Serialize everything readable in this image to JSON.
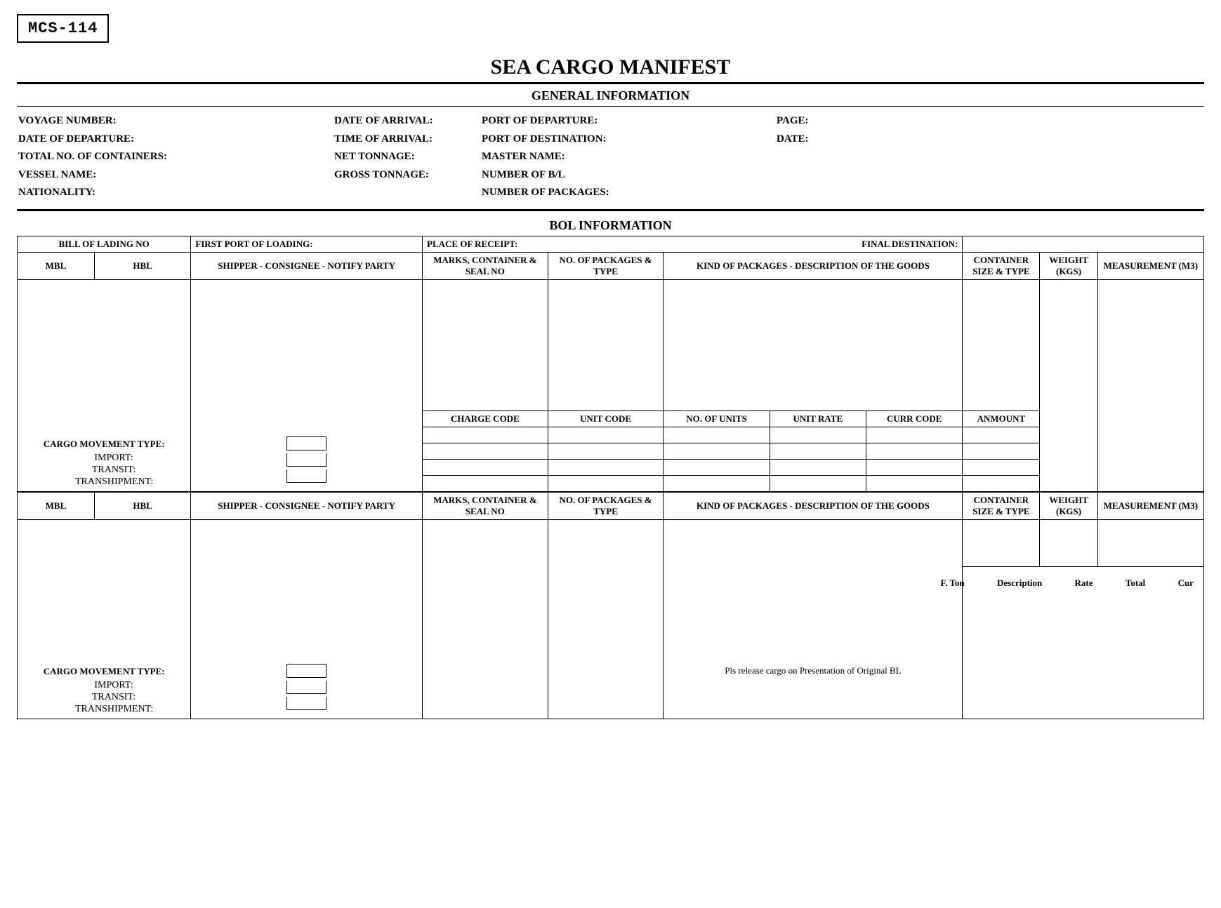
{
  "form_code": "MCS-114",
  "title": "SEA CARGO MANIFEST",
  "sections": {
    "general": "GENERAL INFORMATION",
    "bol": "BOL INFORMATION"
  },
  "general_info": {
    "col1": [
      "VOYAGE NUMBER:",
      "DATE OF DEPARTURE:",
      "TOTAL NO. OF CONTAINERS:",
      "VESSEL NAME:",
      "NATIONALITY:"
    ],
    "col2": [
      "DATE OF ARRIVAL:",
      "TIME OF ARRIVAL:",
      "NET TONNAGE:",
      "GROSS TONNAGE:",
      ""
    ],
    "col3": [
      "PORT OF DEPARTURE:",
      "PORT OF DESTINATION:",
      "MASTER NAME:",
      "NUMBER OF B/L",
      "NUMBER OF PACKAGES:"
    ],
    "col4": [
      "PAGE:",
      "DATE:",
      "",
      "",
      ""
    ]
  },
  "bol": {
    "row1": {
      "bill_of_lading_no": "BILL OF LADING NO",
      "first_port_of_loading": "FIRST PORT OF LOADING:",
      "place_of_receipt": "PLACE OF RECEIPT:",
      "final_destination": "FINAL DESTINATION:"
    },
    "headers": {
      "mbl": "MBL",
      "hbl": "HBL",
      "shipper": "SHIPPER - CONSIGNEE - NOTIFY PARTY",
      "marks_l1": "MARKS, CONTAINER &",
      "marks_l2": "SEAL NO",
      "pkgs_l1": "NO. OF PACKAGES &",
      "pkgs_l2": "TYPE",
      "kind": "KIND OF PACKAGES - DESCRIPTION OF THE GOODS",
      "container_l1": "CONTAINER",
      "container_l2": "SIZE & TYPE",
      "weight_l1": "WEIGHT",
      "weight_l2": "(KGS)",
      "meas": "MEASUREMENT (M3)"
    },
    "charges": {
      "charge_code": "CHARGE CODE",
      "unit_code": "UNIT CODE",
      "no_of_units": "NO. OF UNITS",
      "unit_rate": "UNIT RATE",
      "curr_code": "CURR CODE",
      "amount": "ANMOUNT"
    },
    "cargo_movement": {
      "title": "CARGO MOVEMENT TYPE:",
      "import": "IMPORT:",
      "transit": "TRANSIT:",
      "transhipment": "TRANSHIPMENT:"
    },
    "freight": {
      "fton": "F. Ton",
      "description": "Description",
      "rate": "Rate",
      "total": "Total",
      "cur": "Cur"
    },
    "release_note": "Pls release cargo on Presentation of Original BL"
  }
}
